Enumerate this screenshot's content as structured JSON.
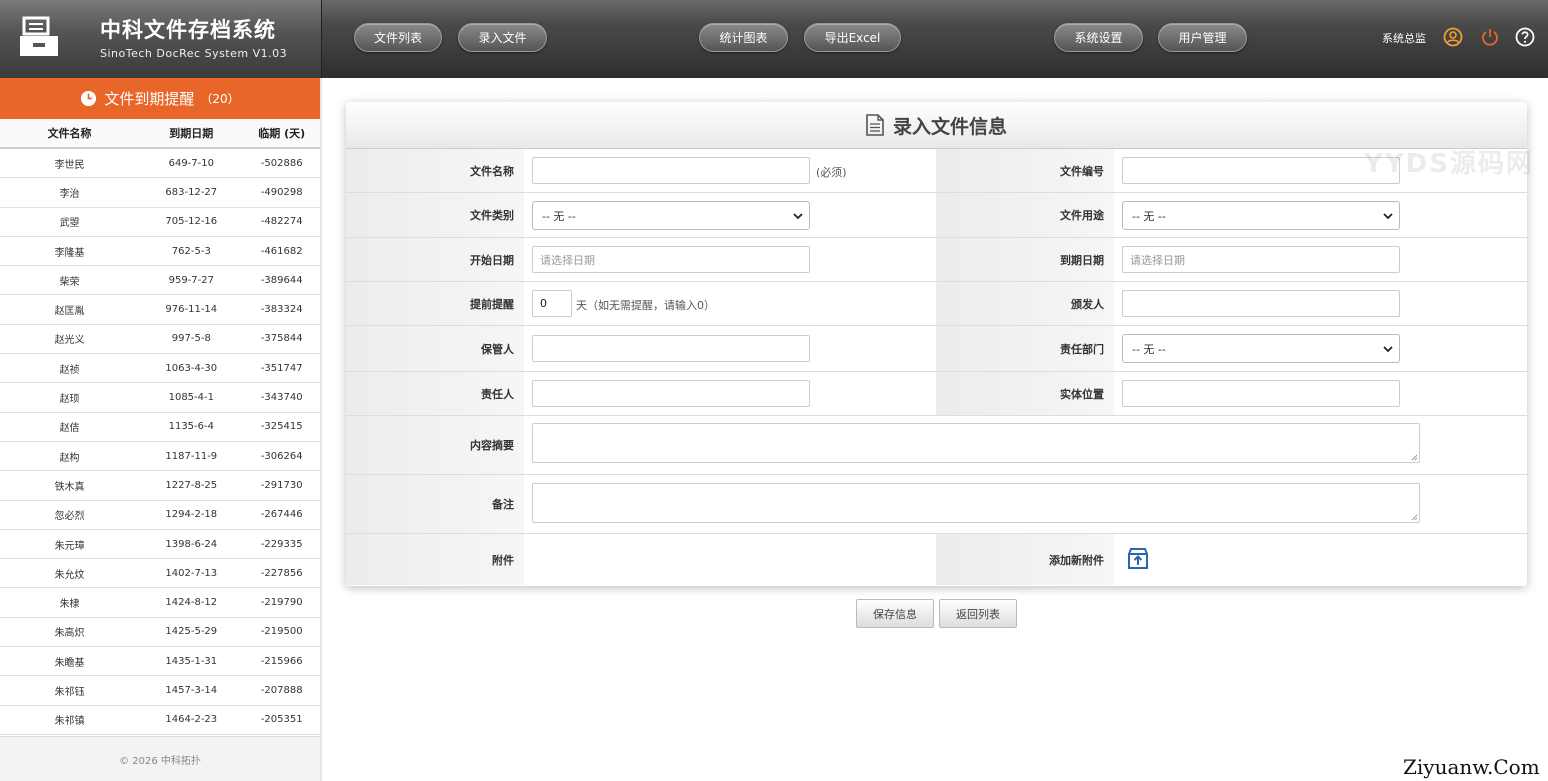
{
  "brand": {
    "title": "中科文件存档系统",
    "subtitle": "SinoTech DocRec System V1.03"
  },
  "nav": {
    "items": [
      "文件列表",
      "录入文件",
      "统计图表",
      "导出Excel",
      "系统设置",
      "用户管理"
    ],
    "user": "系统总监"
  },
  "sidebar": {
    "title": "文件到期提醒",
    "count": "（20）",
    "columns": [
      "文件名称",
      "到期日期",
      "临期 (天)"
    ],
    "rows": [
      [
        "李世民",
        "649-7-10",
        "-502886"
      ],
      [
        "李治",
        "683-12-27",
        "-490298"
      ],
      [
        "武曌",
        "705-12-16",
        "-482274"
      ],
      [
        "李隆基",
        "762-5-3",
        "-461682"
      ],
      [
        "柴荣",
        "959-7-27",
        "-389644"
      ],
      [
        "赵匡胤",
        "976-11-14",
        "-383324"
      ],
      [
        "赵光义",
        "997-5-8",
        "-375844"
      ],
      [
        "赵祯",
        "1063-4-30",
        "-351747"
      ],
      [
        "赵顼",
        "1085-4-1",
        "-343740"
      ],
      [
        "赵佶",
        "1135-6-4",
        "-325415"
      ],
      [
        "赵构",
        "1187-11-9",
        "-306264"
      ],
      [
        "铁木真",
        "1227-8-25",
        "-291730"
      ],
      [
        "忽必烈",
        "1294-2-18",
        "-267446"
      ],
      [
        "朱元璋",
        "1398-6-24",
        "-229335"
      ],
      [
        "朱允炆",
        "1402-7-13",
        "-227856"
      ],
      [
        "朱棣",
        "1424-8-12",
        "-219790"
      ],
      [
        "朱高炽",
        "1425-5-29",
        "-219500"
      ],
      [
        "朱瞻基",
        "1435-1-31",
        "-215966"
      ],
      [
        "朱祁钰",
        "1457-3-14",
        "-207888"
      ],
      [
        "朱祁镇",
        "1464-2-23",
        "-205351"
      ]
    ],
    "footer": "© 2026 中科拓扑"
  },
  "form": {
    "title": "录入文件信息",
    "file_name_label": "文件名称",
    "required_hint": "(必须)",
    "file_no_label": "文件编号",
    "category_label": "文件类别",
    "category_value": "-- 无 --",
    "usage_label": "文件用途",
    "usage_value": "-- 无 --",
    "start_label": "开始日期",
    "start_placeholder": "请选择日期",
    "due_label": "到期日期",
    "due_placeholder": "请选择日期",
    "remind_label": "提前提醒",
    "remind_value": "0",
    "remind_hint": "天（如无需提醒，请输入0）",
    "issuer_label": "颁发人",
    "keeper_label": "保管人",
    "dept_label": "责任部门",
    "dept_value": "-- 无 --",
    "owner_label": "责任人",
    "location_label": "实体位置",
    "summary_label": "内容摘要",
    "note_label": "备注",
    "attach_label": "附件",
    "add_attach_label": "添加新附件"
  },
  "buttons": {
    "save": "保存信息",
    "back": "返回列表"
  },
  "watermarks": {
    "overlay": "YYDS源码网",
    "corner": "Ziyuanw.Com"
  },
  "colors": {
    "accent": "#e9662a",
    "header": "#3a3a3a"
  }
}
